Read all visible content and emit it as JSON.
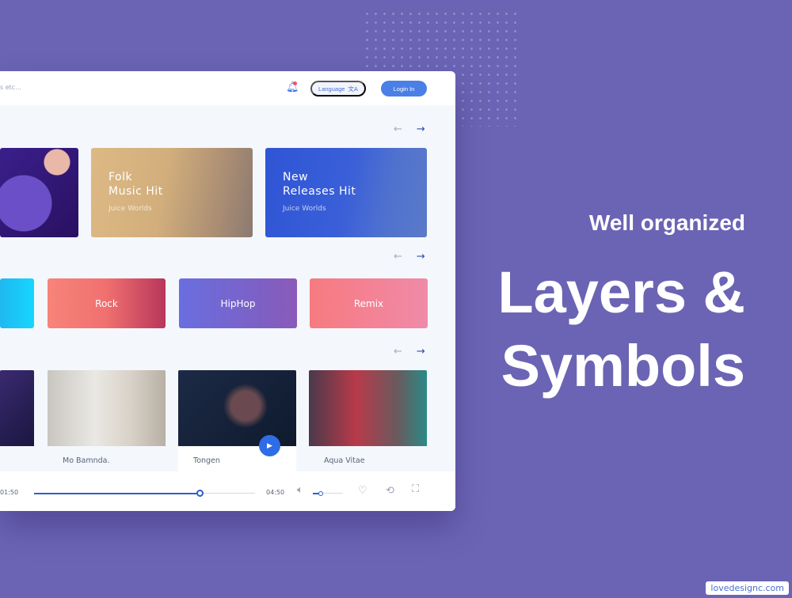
{
  "header": {
    "search_placeholder": "s etc...",
    "language_label": "Language",
    "language_icon": "translate-icon",
    "login_label": "Login In",
    "bell_icon": "bell-icon"
  },
  "featured": {
    "cards": [
      {
        "title": "",
        "subtitle": ""
      },
      {
        "title_line1": "Folk",
        "title_line2": "Music Hit",
        "subtitle": "Juice Worlds"
      },
      {
        "title_line1": "New",
        "title_line2": "Releases Hit",
        "subtitle": "Juice Worlds"
      }
    ]
  },
  "genres": [
    "",
    "Rock",
    "HipHop",
    "Remix"
  ],
  "tracks": [
    {
      "name": ""
    },
    {
      "name": "Mo Bamnda."
    },
    {
      "name": "Tongen"
    },
    {
      "name": "Aqua Vitae"
    }
  ],
  "arrows": {
    "prev": "←",
    "next": "→"
  },
  "player": {
    "elapsed": "01:50",
    "duration": "04:50",
    "progress": 0.75,
    "volume": 0.25
  },
  "promo": {
    "subtitle": "Well organized",
    "line1": "Layers &",
    "line2": "Symbols"
  },
  "watermark": "lovedesignc.com",
  "colors": {
    "background": "#6b64b4",
    "accent": "#4a7fe6"
  }
}
